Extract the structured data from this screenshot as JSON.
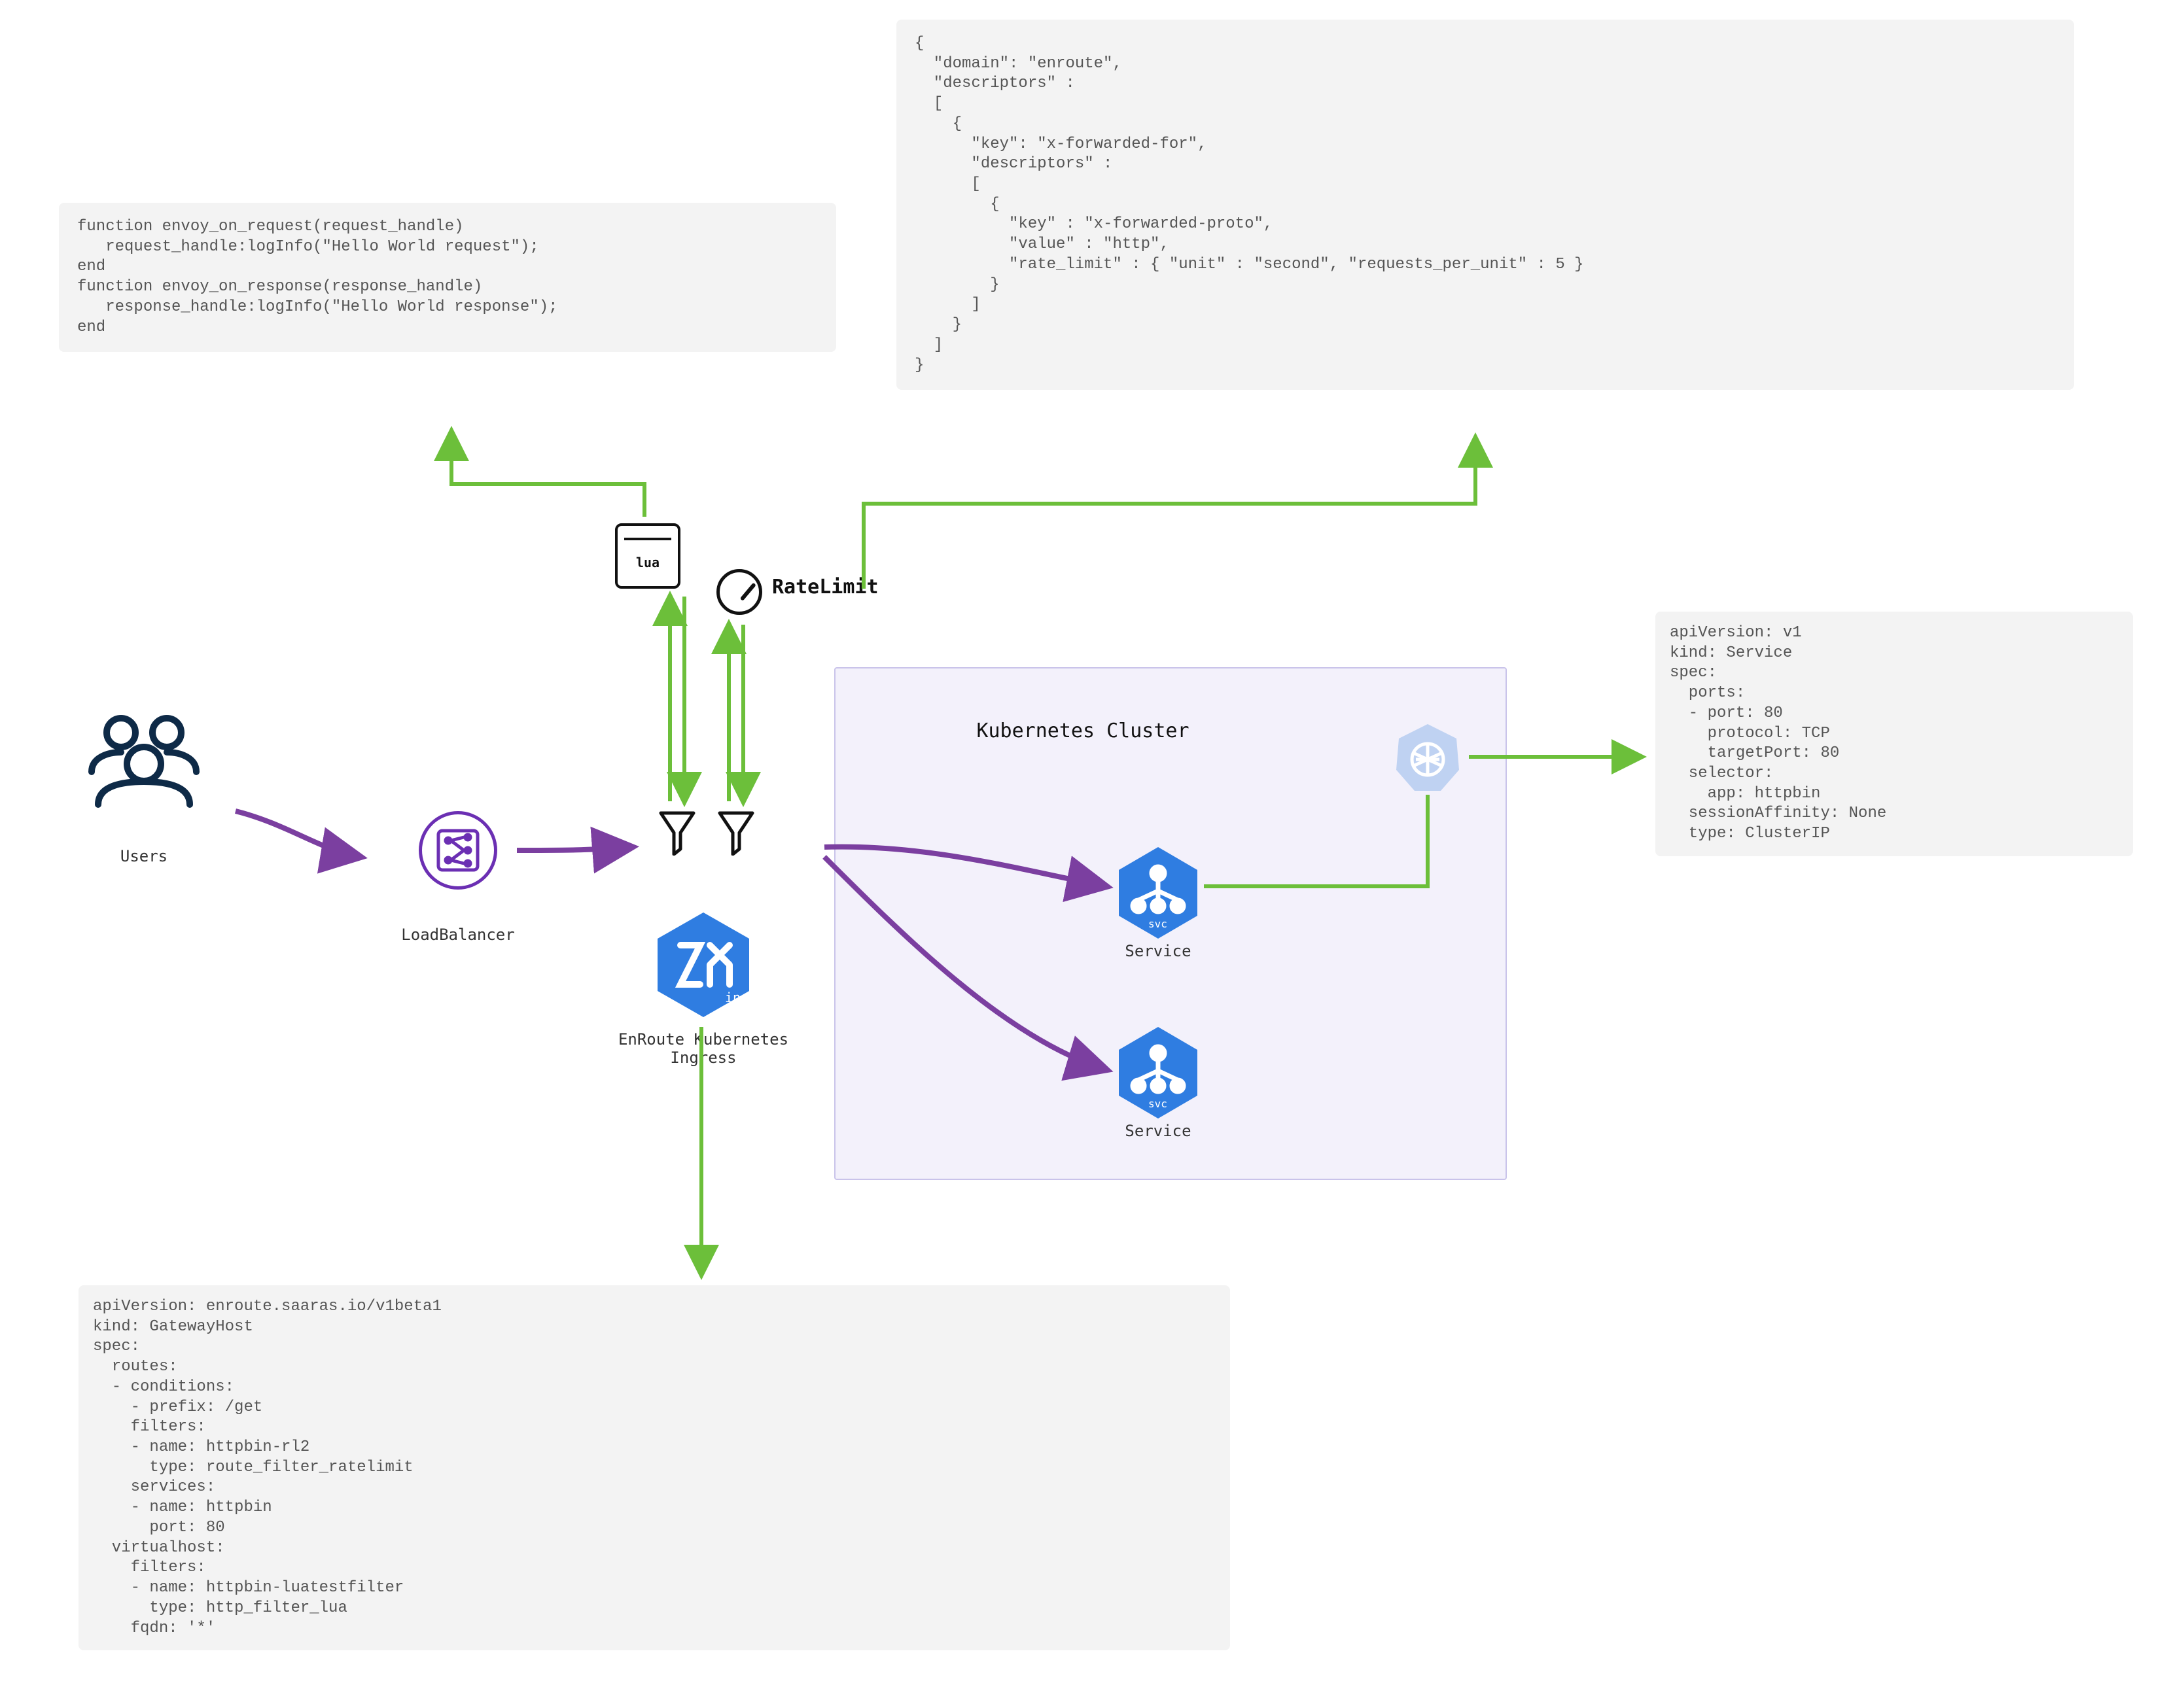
{
  "panels": {
    "lua": "function envoy_on_request(request_handle)\n   request_handle:logInfo(\"Hello World request\");\nend\nfunction envoy_on_response(response_handle)\n   response_handle:logInfo(\"Hello World response\");\nend",
    "ratelimit": "{\n  \"domain\": \"enroute\",\n  \"descriptors\" :\n  [\n    {\n      \"key\": \"x-forwarded-for\",\n      \"descriptors\" :\n      [\n        {\n          \"key\" : \"x-forwarded-proto\",\n          \"value\" : \"http\",\n          \"rate_limit\" : { \"unit\" : \"second\", \"requests_per_unit\" : 5 }\n        }\n      ]\n    }\n  ]\n}",
    "service": "apiVersion: v1\nkind: Service\nspec:\n  ports:\n  - port: 80\n    protocol: TCP\n    targetPort: 80\n  selector:\n    app: httpbin\n  sessionAffinity: None\n  type: ClusterIP",
    "gateway": "apiVersion: enroute.saaras.io/v1beta1\nkind: GatewayHost\nspec:\n  routes:\n  - conditions:\n    - prefix: /get\n    filters:\n    - name: httpbin-rl2\n      type: route_filter_ratelimit\n    services:\n    - name: httpbin\n      port: 80\n  virtualhost:\n    filters:\n    - name: httpbin-luatestfilter\n      type: http_filter_lua\n    fqdn: '*'"
  },
  "labels": {
    "users": "Users",
    "loadbalancer": "LoadBalancer",
    "ingress": "EnRoute Kubernetes\nIngress",
    "ratelimit": "RateLimit",
    "cluster": "Kubernetes Cluster",
    "service": "Service",
    "lua": "lua",
    "ing_tag": "ing",
    "svc_tag": "svc"
  },
  "colors": {
    "purple": "#7b3fa0",
    "ingress_blue": "#2f7de1",
    "green": "#6cbf3a",
    "panel_bg": "#f3f3f3",
    "cluster_bg": "#f3f1fb",
    "cluster_border": "#c9c3ea",
    "k8s_badge": "#bfd2f2",
    "text_mono": "#555555"
  }
}
